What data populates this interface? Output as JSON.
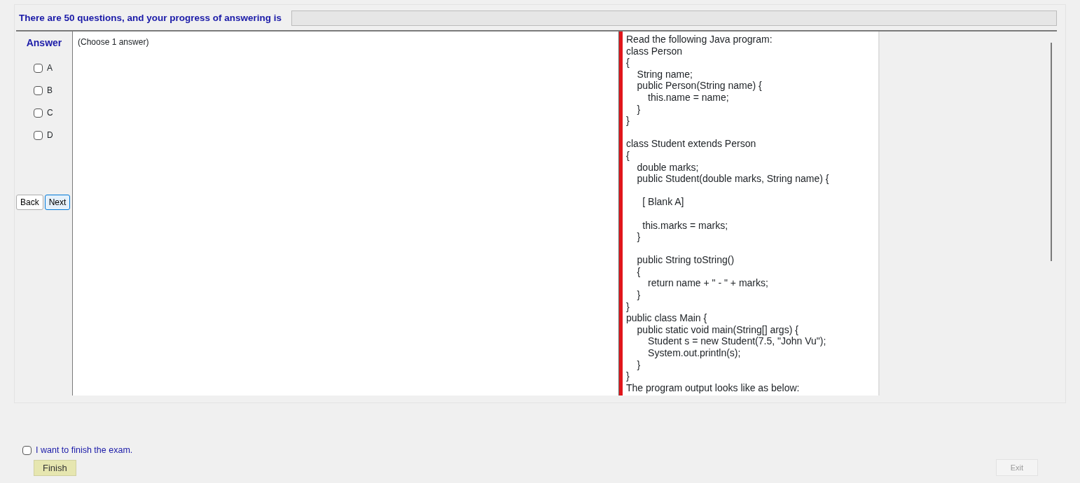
{
  "header": {
    "progress_text": "There are 50 questions, and your progress of answering is",
    "progress": {
      "level": 0
    }
  },
  "answer_panel": {
    "title": "Answer",
    "options": [
      {
        "label": "A",
        "checked": false
      },
      {
        "label": "B",
        "checked": false
      },
      {
        "label": "C",
        "checked": false
      },
      {
        "label": "D",
        "checked": false
      }
    ]
  },
  "nav_buttons": [
    {
      "label": "Back",
      "selected": false
    },
    {
      "label": "Next",
      "selected": true
    }
  ],
  "question": {
    "instruction": "(Choose 1 answer)"
  },
  "code_panel": {
    "blocks": [
      [
        "Read the following Java program:",
        "class Person",
        "{",
        "    String name;",
        "    public Person(String name) {",
        "        this.name = name;",
        "    }",
        "}"
      ],
      [
        "class Student extends Person",
        "{",
        "    double marks;",
        "    public Student(double marks, String name) {"
      ],
      [
        "      [ Blank A]"
      ],
      [
        "      this.marks = marks;",
        "    }"
      ],
      [
        "    public String toString()",
        "    {",
        "        return name + \" - \" + marks;",
        "    }",
        "}",
        "public class Main {",
        "    public static void main(String[] args) {",
        "        Student s = new Student(7.5, \"John Vu\");",
        "        System.out.println(s);",
        "    }",
        "}",
        "The program output looks like as below:"
      ]
    ]
  },
  "footer": {
    "finish_checkbox": {
      "label": "I want to finish the exam.",
      "checked": false
    },
    "finish_button": {
      "label": "Finish",
      "disabled": false
    },
    "exit_button": {
      "label": "Exit",
      "disabled": true
    }
  }
}
